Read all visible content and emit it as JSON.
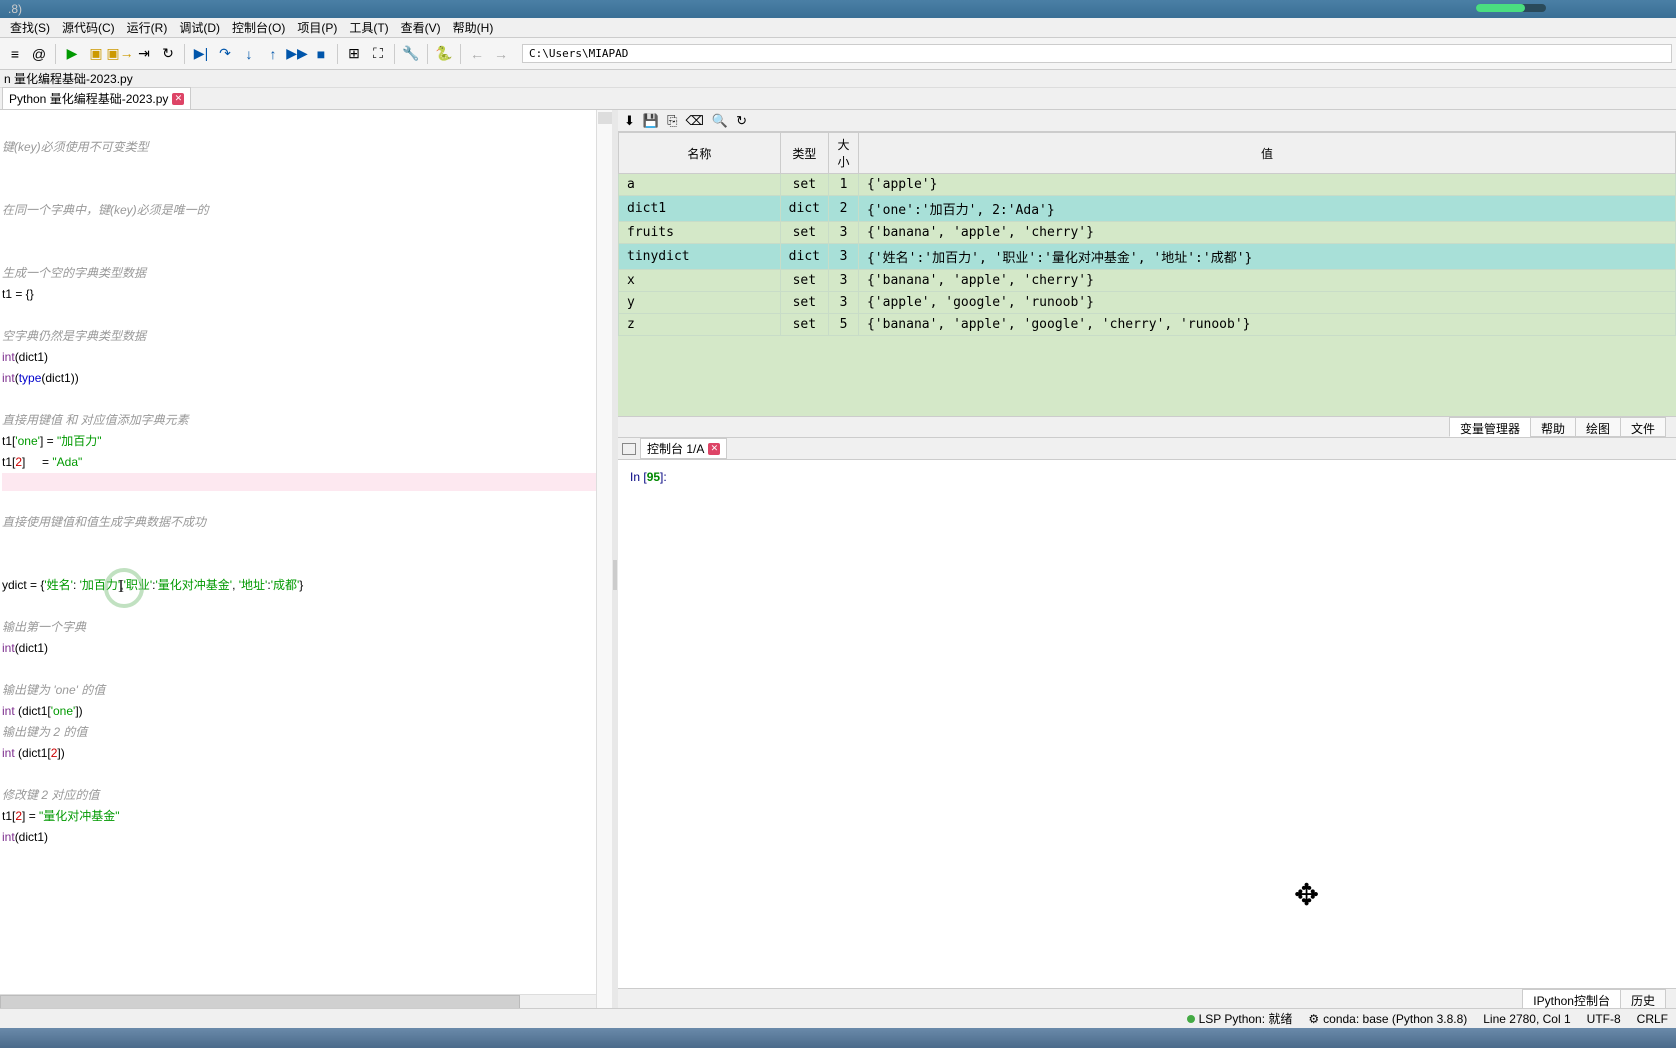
{
  "title": ".8)",
  "menu": [
    "查找(S)",
    "源代码(C)",
    "运行(R)",
    "调试(D)",
    "控制台(O)",
    "项目(P)",
    "工具(T)",
    "查看(V)",
    "帮助(H)"
  ],
  "path": "C:\\Users\\MIAPAD",
  "breadcrumb": "n 量化编程基础-2023.py",
  "file_tab": "Python 量化编程基础-2023.py",
  "code": {
    "c1": "键(key)必须使用不可变类型",
    "c2": "在同一个字典中，键(key)必须是唯一的",
    "c3": "生成一个空的字典类型数据",
    "l1a": "t1 = {}",
    "c4": "空字典仍然是字典类型数据",
    "l2a": "int",
    "l2b": "(dict1)",
    "l3a": "int",
    "l3b": "(",
    "l3c": "type",
    "l3d": "(dict1))",
    "c5": "直接用键值 和 对应值添加字典元素",
    "l4a": "t1[",
    "l4b": "'one'",
    "l4c": "] = ",
    "l4d": "\"加百力\"",
    "l5a": "t1[",
    "l5b": "2",
    "l5c": "]     = ",
    "l5d": "\"Ada\"",
    "c6": "直接使用键值和值生成字典数据不成功",
    "l6a": "ydict = {",
    "l6b": "'姓名'",
    "l6c": ": ",
    "l6d": "'加百力'",
    "l6e": ",",
    "l6f": "'职业'",
    "l6g": ":",
    "l6h": "'量化对冲基金'",
    "l6i": ", ",
    "l6j": "'地址'",
    "l6k": ":",
    "l6l": "'成都'",
    "l6m": "}",
    "c7": "输出第一个字典",
    "l7a": "int",
    "l7b": "(dict1)",
    "c8": "输出键为 'one' 的值",
    "l8a": "int",
    "l8b": " (dict1[",
    "l8c": "'one'",
    "l8d": "])",
    "c9": "输出键为 2 的值",
    "l9a": "int",
    "l9b": " (dict1[",
    "l9c": "2",
    "l9d": "])",
    "c10": "修改键 2 对应的值",
    "l10a": "t1[",
    "l10b": "2",
    "l10c": "] = ",
    "l10d": "\"量化对冲基金\"",
    "l11a": "int",
    "l11b": "(dict1)"
  },
  "var_headers": [
    "名称",
    "类型",
    "大小",
    "值"
  ],
  "vars": [
    {
      "name": "a",
      "type": "set",
      "size": "1",
      "value": "{'apple'}"
    },
    {
      "name": "dict1",
      "type": "dict",
      "size": "2",
      "value": "{'one':'加百力', 2:'Ada'}"
    },
    {
      "name": "fruits",
      "type": "set",
      "size": "3",
      "value": "{'banana', 'apple', 'cherry'}"
    },
    {
      "name": "tinydict",
      "type": "dict",
      "size": "3",
      "value": "{'姓名':'加百力', '职业':'量化对冲基金', '地址':'成都'}"
    },
    {
      "name": "x",
      "type": "set",
      "size": "3",
      "value": "{'banana', 'apple', 'cherry'}"
    },
    {
      "name": "y",
      "type": "set",
      "size": "3",
      "value": "{'apple', 'google', 'runoob'}"
    },
    {
      "name": "z",
      "type": "set",
      "size": "5",
      "value": "{'banana', 'apple', 'google', 'cherry', 'runoob'}"
    }
  ],
  "inspector_tabs": [
    "变量管理器",
    "帮助",
    "绘图",
    "文件"
  ],
  "console_tab": "控制台 1/A",
  "prompt": {
    "pre": "In [",
    "num": "95",
    "post": "]:"
  },
  "bottom_tabs": [
    "IPython控制台",
    "历史"
  ],
  "status": {
    "lsp": "LSP Python: 就绪",
    "conda": "conda: base (Python 3.8.8)",
    "pos": "Line 2780, Col 1",
    "enc": "UTF-8",
    "eol": "CRLF"
  }
}
